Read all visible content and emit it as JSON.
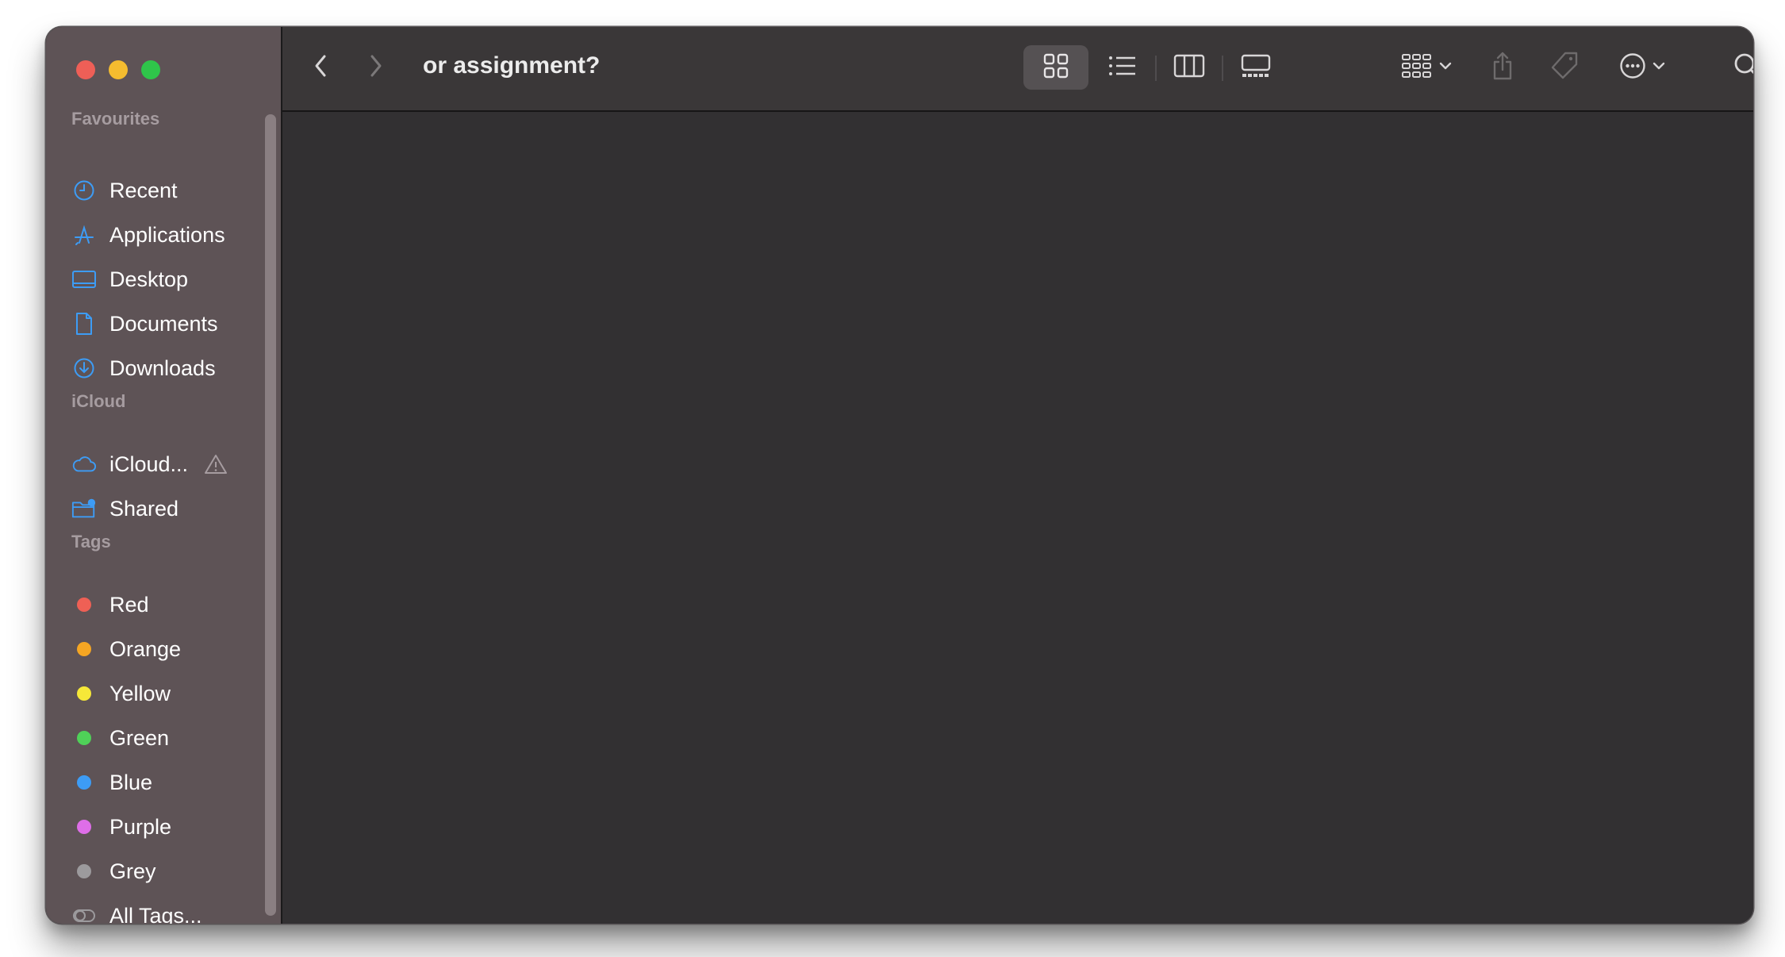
{
  "window": {
    "title": "or assignment?"
  },
  "sidebar": {
    "favourites_title": "Favourites",
    "favourites": [
      {
        "label": "Recent",
        "icon": "clock-icon"
      },
      {
        "label": "Applications",
        "icon": "applications-icon"
      },
      {
        "label": "Desktop",
        "icon": "desktop-icon"
      },
      {
        "label": "Documents",
        "icon": "document-icon"
      },
      {
        "label": "Downloads",
        "icon": "download-icon"
      }
    ],
    "icloud_title": "iCloud",
    "icloud": [
      {
        "label": "iCloud...",
        "icon": "cloud-icon",
        "warning_icon": "warning-icon"
      },
      {
        "label": "Shared",
        "icon": "shared-folder-icon"
      }
    ],
    "tags_title": "Tags",
    "tags": [
      {
        "label": "Red",
        "color": "#ef6055"
      },
      {
        "label": "Orange",
        "color": "#f5a623"
      },
      {
        "label": "Yellow",
        "color": "#f6e838"
      },
      {
        "label": "Green",
        "color": "#4fd158"
      },
      {
        "label": "Blue",
        "color": "#3d9cf5"
      },
      {
        "label": "Purple",
        "color": "#de6ee8"
      },
      {
        "label": "Grey",
        "color": "#9c9a9d"
      },
      {
        "label": "All Tags...",
        "icon": "all-tags-icon"
      }
    ]
  },
  "toolbar": {
    "back_icon": "chevron-left-icon",
    "forward_icon": "chevron-right-icon",
    "views": [
      "icon-view-icon",
      "list-view-icon",
      "column-view-icon",
      "gallery-view-icon"
    ],
    "selected_view": "icon-view-icon",
    "group_icon": "group-icon",
    "share_icon": "share-icon",
    "tag_icon": "tag-icon",
    "more_icon": "more-icon",
    "search_icon": "search-icon"
  },
  "colors": {
    "accent": "#3d9cf5",
    "sidebar_bg": "#5e5356",
    "content_bg": "#323032",
    "toolbar_bg": "#3a3738"
  }
}
